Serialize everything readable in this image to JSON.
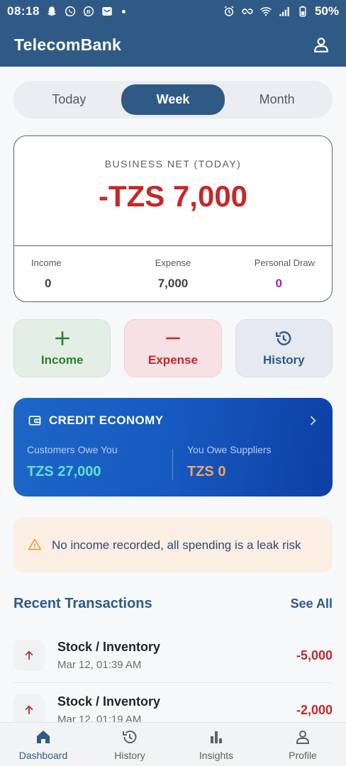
{
  "status_bar": {
    "time": "08:18",
    "battery": "50%",
    "icons_left": [
      "snapchat-icon",
      "whatsapp-icon",
      "whatsapp-business-icon",
      "mail-icon"
    ],
    "icons_right": [
      "alarm-icon",
      "vpn-icon",
      "wifi-icon",
      "signal-icon",
      "battery-icon"
    ]
  },
  "app_bar": {
    "title": "TelecomBank",
    "profile_icon": "person-icon"
  },
  "period_tabs": [
    {
      "label": "Today",
      "active": false
    },
    {
      "label": "Week",
      "active": true
    },
    {
      "label": "Month",
      "active": false
    }
  ],
  "net_card": {
    "label": "BUSINESS NET (TODAY)",
    "value": "-TZS 7,000",
    "stats": [
      {
        "label": "Income",
        "value": "0"
      },
      {
        "label": "Expense",
        "value": "7,000"
      },
      {
        "label": "Personal Draw",
        "value": "0"
      }
    ]
  },
  "actions": [
    {
      "label": "Income",
      "icon": "plus-icon"
    },
    {
      "label": "Expense",
      "icon": "minus-icon"
    },
    {
      "label": "History",
      "icon": "history-icon"
    }
  ],
  "credit": {
    "title": "CREDIT ECONOMY",
    "customers_label": "Customers Owe You",
    "customers_value": "TZS 27,000",
    "suppliers_label": "You Owe Suppliers",
    "suppliers_value": "TZS 0"
  },
  "warning": {
    "text": "No income recorded, all spending is a leak risk"
  },
  "recent": {
    "title": "Recent Transactions",
    "see_all": "See All",
    "items": [
      {
        "title": "Stock / Inventory",
        "date": "Mar 12, 01:39 AM",
        "amount": "-5,000"
      },
      {
        "title": "Stock / Inventory",
        "date": "Mar 12, 01:19 AM",
        "amount": "-2,000"
      }
    ]
  },
  "bottom_nav": [
    {
      "label": "Dashboard",
      "icon": "home-icon",
      "active": true
    },
    {
      "label": "History",
      "icon": "history-icon",
      "active": false
    },
    {
      "label": "Insights",
      "icon": "bar-chart-icon",
      "active": false
    },
    {
      "label": "Profile",
      "icon": "person-icon",
      "active": false
    }
  ],
  "colors": {
    "primary": "#2f5a86",
    "negative": "#c62828",
    "positive": "#2e7d32",
    "credit_start": "#1e66c8",
    "credit_end": "#0d3fa4",
    "teal": "#5ee0d3",
    "orange": "#f2a55a",
    "purple": "#9c27b0"
  }
}
